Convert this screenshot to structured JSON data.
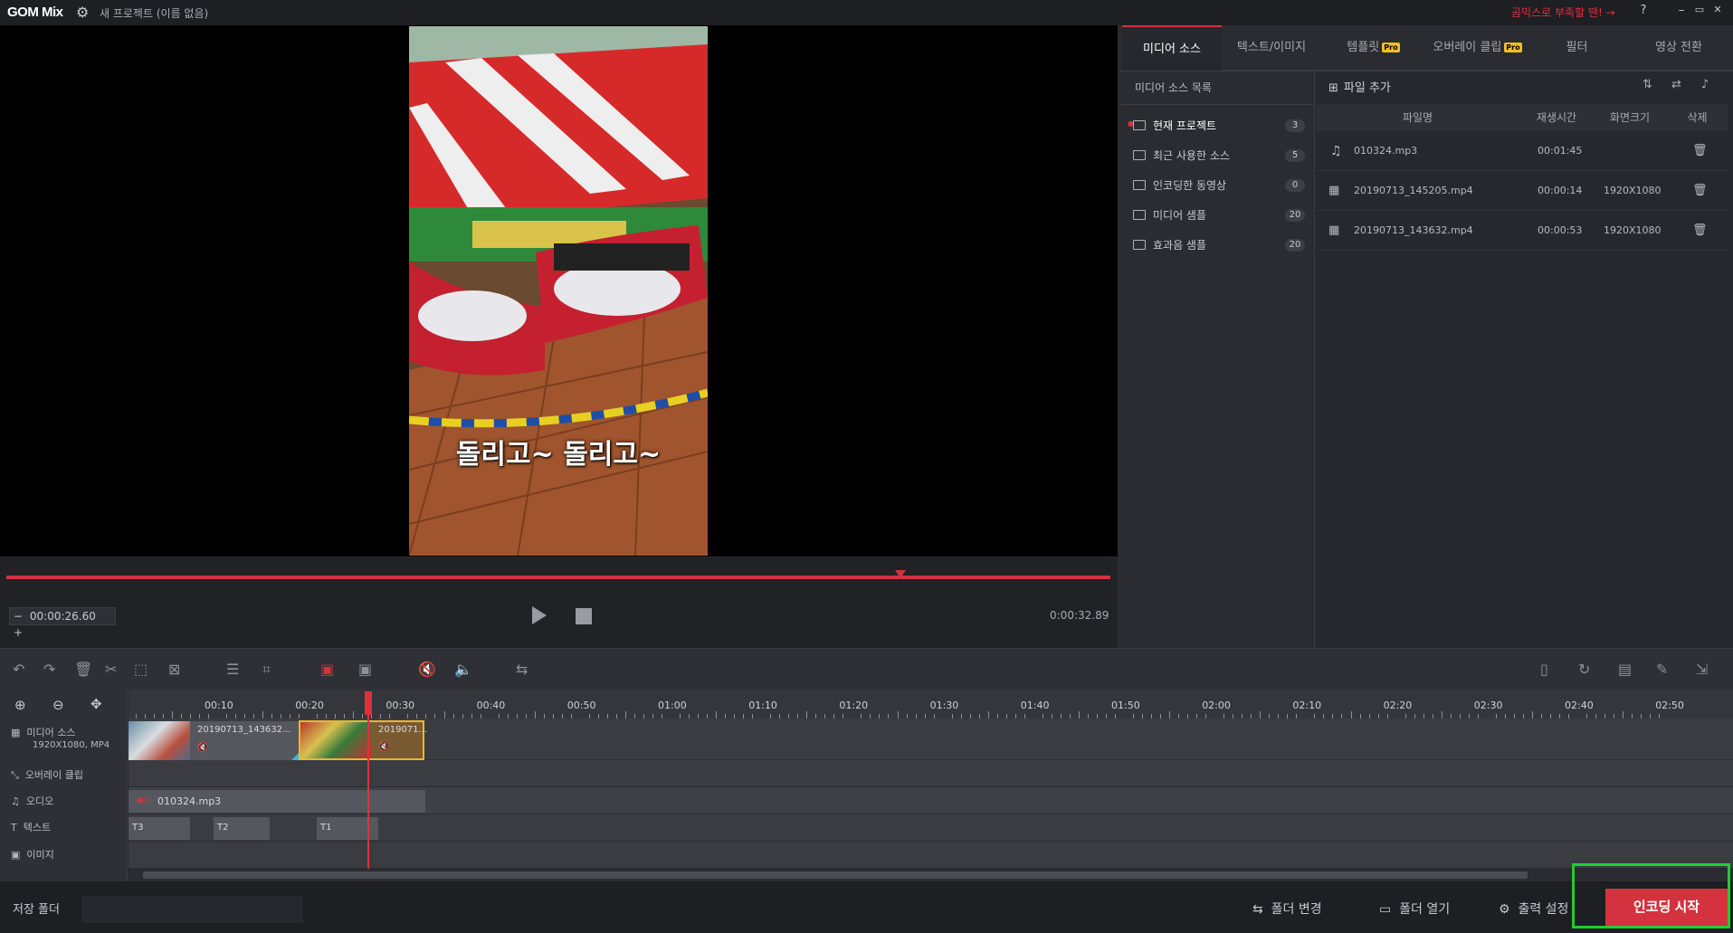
{
  "app": {
    "logo": "GOM Mix",
    "project_title": "새 프로젝트 (이름 없음)",
    "promo_text": "곰믹스로 부족할 땐! →",
    "help": "?",
    "win_min": "–",
    "win_max": "▭",
    "win_close": "✕"
  },
  "preview": {
    "subtitle": "돌리고~ 돌리고~",
    "current_time": "00:00:26.60",
    "total_time": "0:00:32.89",
    "progress_fraction": 0.81,
    "minus": "−",
    "plus": "+"
  },
  "tabs": [
    {
      "label": "미디어 소스",
      "active": true
    },
    {
      "label": "텍스트/이미지",
      "active": false
    },
    {
      "label": "템플릿",
      "pro": "Pro",
      "active": false
    },
    {
      "label": "오버레이 클립",
      "pro": "Pro",
      "active": false
    },
    {
      "label": "필터",
      "active": false
    },
    {
      "label": "영상 전환",
      "active": false
    }
  ],
  "media_source": {
    "list_title": "미디어 소스 목록",
    "add_file": "파일 추가",
    "folders": [
      {
        "label": "현재 프로젝트",
        "count": "3",
        "active": true
      },
      {
        "label": "최근 사용한 소스",
        "count": "5"
      },
      {
        "label": "인코딩한 동영상",
        "count": "0"
      },
      {
        "label": "미디어 샘플",
        "count": "20"
      },
      {
        "label": "효과음 샘플",
        "count": "20"
      }
    ],
    "columns": {
      "name": "파일명",
      "duration": "재생시간",
      "resolution": "화면크기",
      "delete": "삭제"
    },
    "files": [
      {
        "icon": "music-note-icon",
        "name": "010324.mp3",
        "duration": "00:01:45",
        "resolution": ""
      },
      {
        "icon": "film-icon",
        "name": "20190713_145205.mp4",
        "duration": "00:00:14",
        "resolution": "1920X1080"
      },
      {
        "icon": "film-icon",
        "name": "20190713_143632.mp4",
        "duration": "00:00:53",
        "resolution": "1920X1080"
      }
    ]
  },
  "timeline": {
    "ticks": [
      "00:10",
      "00:20",
      "00:30",
      "00:40",
      "00:50",
      "01:00",
      "01:10",
      "01:20",
      "01:30",
      "01:40",
      "01:50",
      "02:00",
      "02:10",
      "02:20",
      "02:30",
      "02:40",
      "02:50"
    ],
    "tracks": {
      "media": "미디어 소스",
      "media_sub": "1920X1080, MP4",
      "overlay": "오버레이 클립",
      "audio": "오디오",
      "text": "텍스트",
      "image": "이미지"
    },
    "clips": {
      "video1": "20190713_143632...",
      "video2": "2019071...",
      "audio1": "010324.mp3",
      "t3": "T3",
      "t2": "T2",
      "t1": "T1"
    }
  },
  "bottom": {
    "save_folder": "저장 폴더",
    "change_folder": "폴더 변경",
    "open_folder": "폴더 열기",
    "output_settings": "출력 설정",
    "encode_start": "인코딩 시작"
  },
  "colors": {
    "accent": "#d4323e",
    "highlight": "#22cc33",
    "pro_badge": "#f0c020"
  }
}
